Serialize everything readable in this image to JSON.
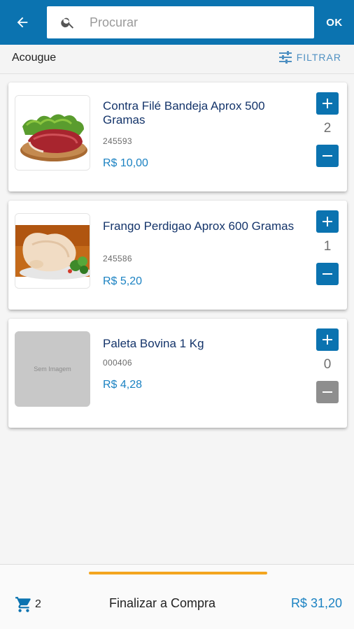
{
  "header": {
    "search_placeholder": "Procurar",
    "search_value": "",
    "ok_label": "OK",
    "back_icon": "arrow-left-icon",
    "search_icon": "magnify-icon",
    "bg_color": "#0b73b0"
  },
  "subheader": {
    "category": "Acougue",
    "filter_label": "FILTRAR",
    "filter_icon": "sliders-icon"
  },
  "products": [
    {
      "name": "Contra Filé Bandeja Aprox 500 Gramas",
      "code": "245593",
      "price": "R$ 10,00",
      "quantity": "2",
      "image": "beef-steak-photo"
    },
    {
      "name": "Frango Perdigao Aprox 600 Gramas",
      "code": "245586",
      "price": "R$ 5,20",
      "quantity": "1",
      "image": "raw-chicken-photo"
    },
    {
      "name": "Paleta Bovina 1 Kg",
      "code": "000406",
      "price": "R$ 4,28",
      "quantity": "0",
      "image": "placeholder",
      "no_image_text": "Sem Imagem"
    }
  ],
  "footer": {
    "cart_count": "2",
    "cart_icon": "cart-icon",
    "finalize_label": "Finalizar a Compra",
    "total": "R$ 31,20",
    "accent_color": "#f3a51f"
  }
}
